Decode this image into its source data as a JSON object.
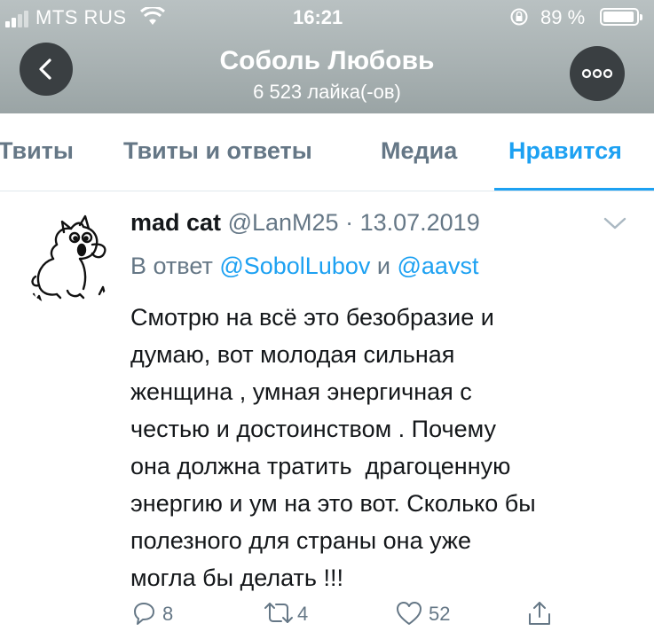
{
  "status_bar": {
    "carrier": "MTS RUS",
    "time": "16:21",
    "battery": "89 %",
    "battery_level": 0.89,
    "icons": [
      "signal-icon",
      "wifi-icon",
      "rotation-lock-icon",
      "battery-icon"
    ]
  },
  "header": {
    "name": "Соболь Любовь",
    "likes": "6 523 лайка(-ов)",
    "back_icon": "chevron-left-icon",
    "more_icon": "more-dots-icon"
  },
  "tabs": [
    {
      "label": "Твиты",
      "active": false
    },
    {
      "label": "Твиты и ответы",
      "active": false
    },
    {
      "label": "Медиа",
      "active": false
    },
    {
      "label": "Нравится",
      "active": true
    }
  ],
  "tweet": {
    "author": "mad cat",
    "handle": "@LanM25",
    "separator": "·",
    "date": "13.07.2019",
    "reply_prefix": "В ответ",
    "reply_to_1": "@SobolLubov",
    "reply_and": "и",
    "reply_to_2": "@aavst",
    "text_lines": [
      "Смотрю на всё это безобразие и",
      "думаю, вот молодая сильная",
      "женщина , умная энергичная с",
      "честью и достоинством . Почему",
      "она должна тратить  драгоценную",
      "энергию и ум на это вот. Сколько бы",
      "полезного для страны она уже",
      "могла бы делать !!!"
    ],
    "actions": {
      "replies": "8",
      "retweets": "4",
      "likes": "52"
    }
  },
  "colors": {
    "accent": "#1da1f2",
    "muted": "#657786",
    "text": "#14171a",
    "nav_button": "#3a3f42"
  }
}
